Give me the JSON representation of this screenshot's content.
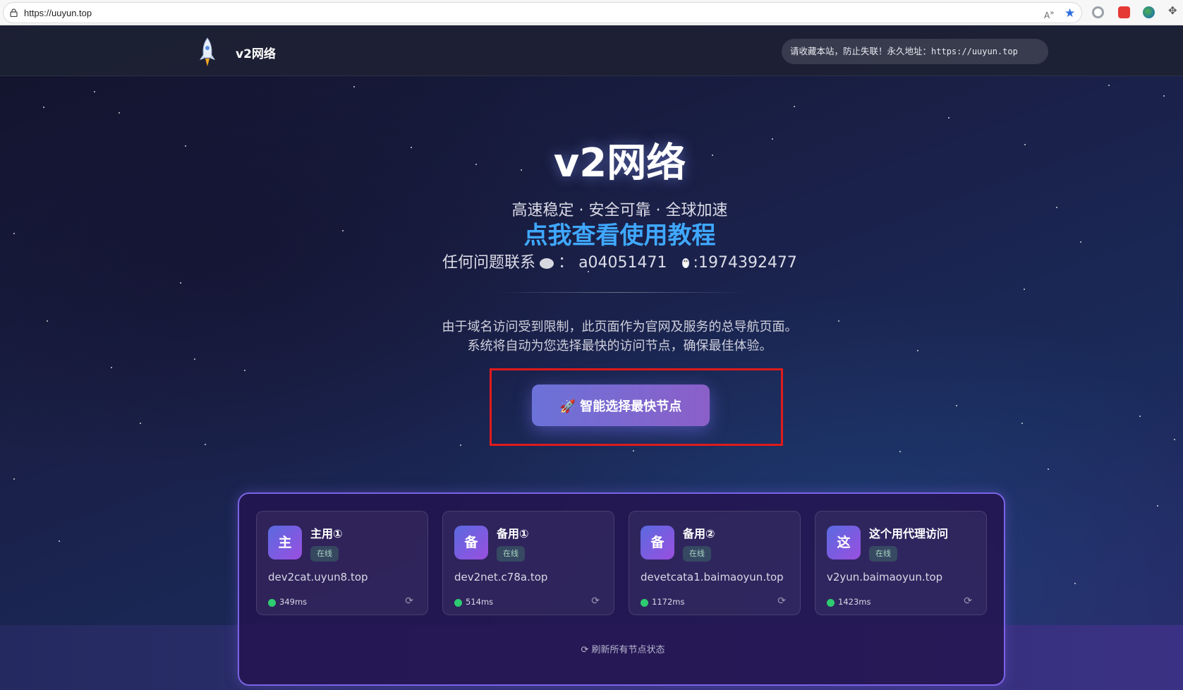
{
  "browser": {
    "url": "https://uuyun.top"
  },
  "navbar": {
    "brand": "v2网络",
    "notice_text": "请收藏本站，防止失联！永久地址：",
    "notice_url": "https://uuyun.top"
  },
  "hero": {
    "title": "v2网络",
    "subtitle": "高速稳定 · 安全可靠 · 全球加速",
    "tutorial_link": "点我查看使用教程",
    "contact_prefix": "任何问题联系",
    "wechat_sep": "：",
    "wechat_id": "a04051471",
    "qq_id": ":1974392477"
  },
  "description": {
    "line1": "由于域名访问受到限制，此页面作为官网及服务的总导航页面。",
    "line2": "系统将自动为您选择最快的访问节点，确保最佳体验。"
  },
  "smart_button": {
    "icon": "rocket-icon",
    "label": "智能选择最快节点"
  },
  "nodes": [
    {
      "avatar": "主",
      "name": "主用①",
      "status": "在线",
      "domain": "dev2cat.uyun8.top",
      "latency": "349ms"
    },
    {
      "avatar": "备",
      "name": "备用①",
      "status": "在线",
      "domain": "dev2net.c78a.top",
      "latency": "514ms"
    },
    {
      "avatar": "备",
      "name": "备用②",
      "status": "在线",
      "domain": "devetcata1.baimaoyun.top",
      "latency": "1172ms"
    },
    {
      "avatar": "这",
      "name": "这个用代理访问",
      "status": "在线",
      "domain": "v2yun.baimaoyun.top",
      "latency": "1423ms"
    }
  ],
  "refresh_all": "刷新所有节点状态",
  "colors": {
    "accent": "#7a63e6",
    "link": "#3fa8ff",
    "online": "#2ecc71",
    "highlight": "#e01b1b"
  }
}
